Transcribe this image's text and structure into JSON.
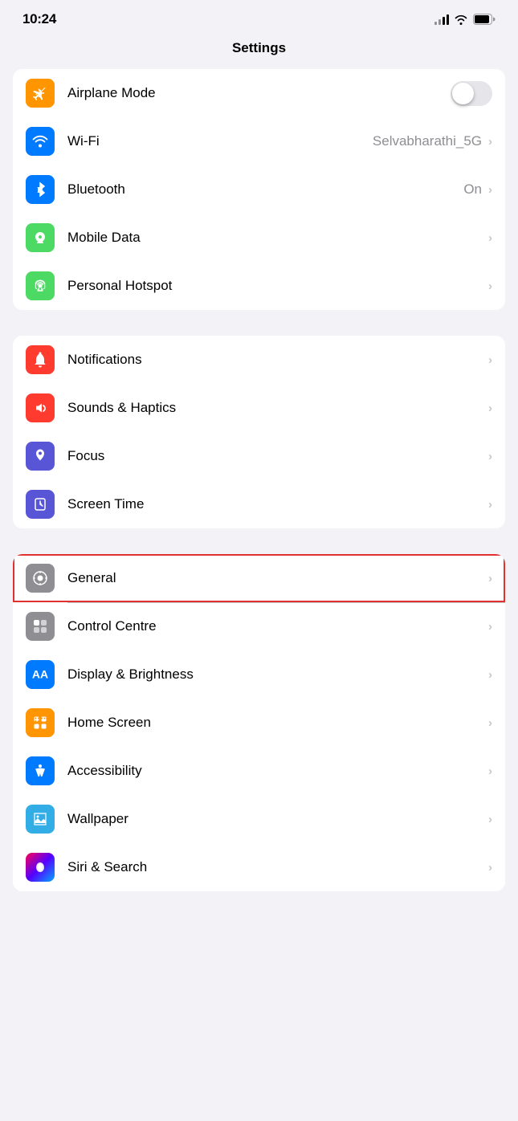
{
  "statusBar": {
    "time": "10:24",
    "wifi": "connected",
    "battery": "full"
  },
  "pageTitle": "Settings",
  "groups": [
    {
      "id": "network",
      "rows": [
        {
          "id": "airplane-mode",
          "label": "Airplane Mode",
          "iconBg": "#ff9500",
          "iconType": "airplane",
          "valueType": "toggle",
          "toggleOn": false
        },
        {
          "id": "wifi",
          "label": "Wi-Fi",
          "iconBg": "#007aff",
          "iconType": "wifi",
          "valueType": "text-chevron",
          "value": "Selvabharathi_5G"
        },
        {
          "id": "bluetooth",
          "label": "Bluetooth",
          "iconBg": "#007aff",
          "iconType": "bluetooth",
          "valueType": "text-chevron",
          "value": "On"
        },
        {
          "id": "mobile-data",
          "label": "Mobile Data",
          "iconBg": "#4cd964",
          "iconType": "mobile-data",
          "valueType": "chevron"
        },
        {
          "id": "personal-hotspot",
          "label": "Personal Hotspot",
          "iconBg": "#4cd964",
          "iconType": "hotspot",
          "valueType": "chevron"
        }
      ]
    },
    {
      "id": "notifications",
      "rows": [
        {
          "id": "notifications",
          "label": "Notifications",
          "iconBg": "#ff3b30",
          "iconType": "notifications",
          "valueType": "chevron"
        },
        {
          "id": "sounds-haptics",
          "label": "Sounds & Haptics",
          "iconBg": "#ff3b30",
          "iconType": "sounds",
          "valueType": "chevron"
        },
        {
          "id": "focus",
          "label": "Focus",
          "iconBg": "#5856d6",
          "iconType": "focus",
          "valueType": "chevron"
        },
        {
          "id": "screen-time",
          "label": "Screen Time",
          "iconBg": "#5856d6",
          "iconType": "screen-time",
          "valueType": "chevron"
        }
      ]
    },
    {
      "id": "general-section",
      "rows": [
        {
          "id": "general",
          "label": "General",
          "iconBg": "#8e8e93",
          "iconType": "general",
          "valueType": "chevron",
          "highlighted": true
        },
        {
          "id": "control-centre",
          "label": "Control Centre",
          "iconBg": "#8e8e93",
          "iconType": "control-centre",
          "valueType": "chevron"
        },
        {
          "id": "display-brightness",
          "label": "Display & Brightness",
          "iconBg": "#007aff",
          "iconType": "display",
          "valueType": "chevron"
        },
        {
          "id": "home-screen",
          "label": "Home Screen",
          "iconBg": "#ff9500",
          "iconType": "home-screen",
          "valueType": "chevron"
        },
        {
          "id": "accessibility",
          "label": "Accessibility",
          "iconBg": "#007aff",
          "iconType": "accessibility",
          "valueType": "chevron"
        },
        {
          "id": "wallpaper",
          "label": "Wallpaper",
          "iconBg": "#32ade6",
          "iconType": "wallpaper",
          "valueType": "chevron"
        },
        {
          "id": "siri-search",
          "label": "Siri & Search",
          "iconBg": "siri-gradient",
          "iconType": "siri",
          "valueType": "chevron"
        }
      ]
    }
  ]
}
